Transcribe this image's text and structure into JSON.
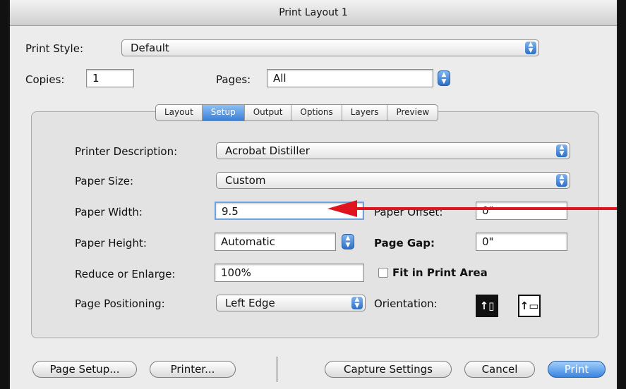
{
  "window": {
    "title": "Print Layout 1"
  },
  "print_style": {
    "label": "Print Style:",
    "value": "Default"
  },
  "copies": {
    "label": "Copies:",
    "value": "1"
  },
  "pages": {
    "label": "Pages:",
    "value": "All"
  },
  "tabs": [
    {
      "label": "Layout",
      "selected": false
    },
    {
      "label": "Setup",
      "selected": true
    },
    {
      "label": "Output",
      "selected": false
    },
    {
      "label": "Options",
      "selected": false
    },
    {
      "label": "Layers",
      "selected": false
    },
    {
      "label": "Preview",
      "selected": false
    }
  ],
  "setup": {
    "printer_description": {
      "label": "Printer Description:",
      "value": "Acrobat Distiller"
    },
    "paper_size": {
      "label": "Paper Size:",
      "value": "Custom"
    },
    "paper_width": {
      "label": "Paper Width:",
      "value": "9.5"
    },
    "paper_offset": {
      "label": "Paper Offset:",
      "value": "0\""
    },
    "paper_height": {
      "label": "Paper Height:",
      "value": "Automatic"
    },
    "page_gap": {
      "label": "Page Gap:",
      "value": "0\""
    },
    "reduce_enlarge": {
      "label": "Reduce or Enlarge:",
      "value": "100%"
    },
    "fit_in_print_area": {
      "label": "Fit in Print Area",
      "checked": false
    },
    "page_positioning": {
      "label": "Page Positioning:",
      "value": "Left Edge"
    },
    "orientation": {
      "label": "Orientation:",
      "selected": "portrait",
      "icons": [
        "portrait-orientation-icon",
        "landscape-orientation-icon"
      ]
    }
  },
  "annotation_arrow": {
    "color": "#e0141e"
  },
  "buttons": {
    "page_setup": "Page Setup...",
    "printer": "Printer...",
    "capture_settings": "Capture Settings",
    "cancel": "Cancel",
    "print": "Print"
  },
  "colors": {
    "accent": "#3a84e0",
    "arrow": "#e0141e"
  }
}
